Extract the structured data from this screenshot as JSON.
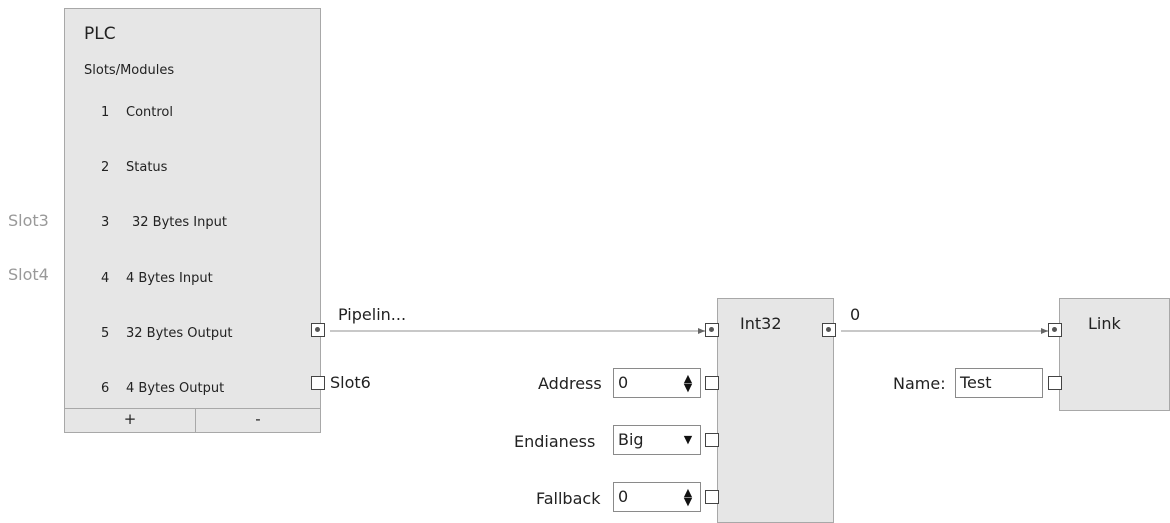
{
  "plc": {
    "title": "PLC",
    "subtitle": "Slots/Modules",
    "modules": [
      {
        "num": "1",
        "label": "Control"
      },
      {
        "num": "2",
        "label": "Status"
      },
      {
        "num": "3",
        "label": "32 Bytes Input"
      },
      {
        "num": "4",
        "label": "4 Bytes Input"
      },
      {
        "num": "5",
        "label": "32 Bytes Output"
      },
      {
        "num": "6",
        "label": "4 Bytes Output"
      }
    ],
    "slot_labels": [
      "Slot3",
      "Slot4"
    ],
    "add_label": "+",
    "remove_label": "-",
    "output_pipeline_label": "Pipelin...",
    "output_slot6_label": "Slot6"
  },
  "int32": {
    "title": "Int32",
    "output_label": "0",
    "address": {
      "label": "Address",
      "value": "0"
    },
    "endianess": {
      "label": "Endianess",
      "value": "Big"
    },
    "fallback": {
      "label": "Fallback",
      "value": "0"
    }
  },
  "link": {
    "title": "Link",
    "name": {
      "label": "Name:",
      "value": "Test"
    }
  },
  "icons": {
    "spinner": "spinner-arrows-icon",
    "dropdown": "chevron-down-icon"
  }
}
